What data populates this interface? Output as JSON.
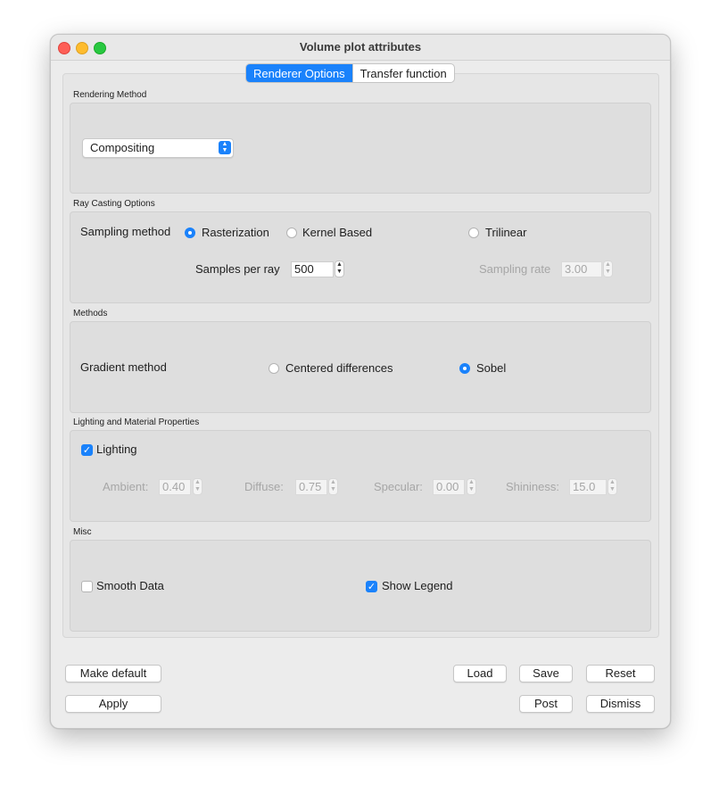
{
  "window": {
    "title": "Volume plot attributes"
  },
  "tabs": [
    {
      "label": "Renderer Options",
      "active": true
    },
    {
      "label": "Transfer function",
      "active": false
    }
  ],
  "rendering_method": {
    "group_label": "Rendering Method",
    "selected": "Compositing"
  },
  "ray_casting": {
    "group_label": "Ray Casting Options",
    "sampling_method_label": "Sampling method",
    "options": [
      "Rasterization",
      "Kernel Based",
      "Trilinear"
    ],
    "selected": "Rasterization",
    "samples_per_ray_label": "Samples per ray",
    "samples_per_ray_value": "500",
    "sampling_rate_label": "Sampling rate",
    "sampling_rate_value": "3.00"
  },
  "methods": {
    "group_label": "Methods",
    "gradient_method_label": "Gradient method",
    "options": [
      "Centered differences",
      "Sobel"
    ],
    "selected": "Sobel"
  },
  "lighting": {
    "group_label": "Lighting and Material Properties",
    "lighting_label": "Lighting",
    "lighting_checked": true,
    "ambient_label": "Ambient:",
    "ambient_value": "0.40",
    "diffuse_label": "Diffuse:",
    "diffuse_value": "0.75",
    "specular_label": "Specular:",
    "specular_value": "0.00",
    "shininess_label": "Shininess:",
    "shininess_value": "15.0"
  },
  "misc": {
    "group_label": "Misc",
    "smooth_data_label": "Smooth Data",
    "smooth_data_checked": false,
    "show_legend_label": "Show Legend",
    "show_legend_checked": true
  },
  "buttons": {
    "make_default": "Make default",
    "apply": "Apply",
    "load": "Load",
    "save": "Save",
    "reset": "Reset",
    "post": "Post",
    "dismiss": "Dismiss"
  },
  "colors": {
    "accent": "#1a82fb",
    "window_bg": "#ececec",
    "group_bg": "#dedede",
    "disabled_text": "#a6a6a6"
  }
}
